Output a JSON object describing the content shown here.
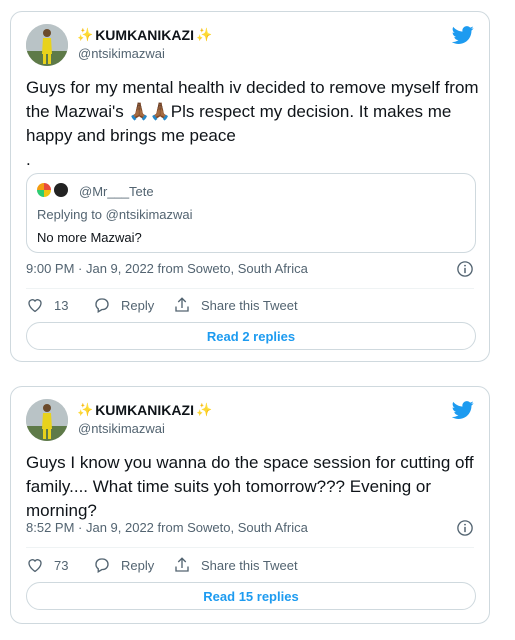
{
  "tweets": [
    {
      "display_name": "KUMKANIKAZI",
      "handle": "@ntsikimazwai",
      "text": "Guys for my mental health iv decided to remove myself from the Mazwai's 🙏🏾🙏🏾Pls respect my decision. It makes me happy and brings me peace\n.",
      "quote": {
        "handle": "@Mr___Tete",
        "replying_to": "Replying to @ntsikimazwai",
        "text": "No more Mazwai?"
      },
      "meta": "9:00 PM · Jan 9, 2022 from Soweto, South Africa",
      "likes": "13",
      "reply_label": "Reply",
      "share_label": "Share this Tweet",
      "read_replies_label": "Read 2 replies"
    },
    {
      "display_name": "KUMKANIKAZI",
      "handle": "@ntsikimazwai",
      "text": "Guys I know you wanna do the space session for cutting off family.... What time suits yoh tomorrow??? Evening or morning?",
      "meta": "8:52 PM · Jan 9, 2022 from Soweto, South Africa",
      "likes": "73",
      "reply_label": "Reply",
      "share_label": "Share this Tweet",
      "read_replies_label": "Read 15 replies"
    }
  ],
  "icons": {
    "bird": "twitter-bird-icon",
    "info": "info-icon",
    "like": "heart-icon",
    "reply": "reply-icon",
    "share": "share-icon",
    "sparkle": "sparkle-icon"
  },
  "colors": {
    "twitter_blue": "#1d9bf0",
    "secondary_text": "#536471",
    "border": "#cfd9de"
  }
}
